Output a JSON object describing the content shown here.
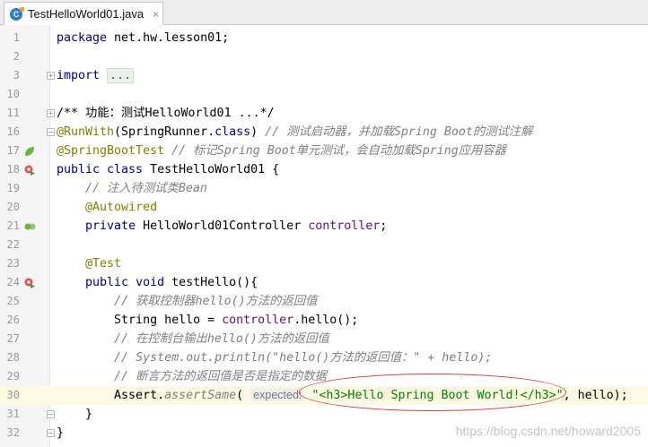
{
  "tab": {
    "icon": "java-class-icon",
    "label": "TestHelloWorld01.java",
    "close": "×"
  },
  "lines": [
    {
      "n": "1",
      "parts": [
        [
          "kw",
          "package "
        ],
        [
          "",
          "net.hw.lesson01;"
        ]
      ]
    },
    {
      "n": "2",
      "parts": []
    },
    {
      "n": "3",
      "parts": [
        [
          "kw",
          "import "
        ],
        [
          "fold-ph",
          "..."
        ]
      ]
    },
    {
      "n": "10",
      "parts": []
    },
    {
      "n": "11",
      "parts": [
        [
          "doc",
          "/** 功能：测试HelloWorld01 ...*/"
        ]
      ]
    },
    {
      "n": "16",
      "parts": [
        [
          "ann",
          "@RunWith"
        ],
        [
          "",
          "(SpringRunner."
        ],
        [
          "kw",
          "class"
        ],
        [
          "",
          ") "
        ],
        [
          "cmt",
          "// 测试启动器，并加载Spring Boot的测试注解"
        ]
      ]
    },
    {
      "n": "17",
      "parts": [
        [
          "ann",
          "@SpringBootTest "
        ],
        [
          "cmt",
          "// 标记Spring Boot单元测试，会自动加载Spring应用容器"
        ]
      ]
    },
    {
      "n": "18",
      "parts": [
        [
          "kw",
          "public class "
        ],
        [
          "",
          "TestHelloWorld01 {"
        ]
      ]
    },
    {
      "n": "19",
      "parts": [
        [
          "",
          "    "
        ],
        [
          "cmt",
          "// 注入待测试类Bean"
        ]
      ]
    },
    {
      "n": "20",
      "parts": [
        [
          "",
          "    "
        ],
        [
          "ann",
          "@Autowired"
        ]
      ]
    },
    {
      "n": "21",
      "parts": [
        [
          "",
          "    "
        ],
        [
          "kw",
          "private "
        ],
        [
          "",
          "HelloWorld01Controller "
        ],
        [
          "fld",
          "controller"
        ],
        [
          "",
          ";"
        ]
      ]
    },
    {
      "n": "22",
      "parts": []
    },
    {
      "n": "23",
      "parts": [
        [
          "",
          "    "
        ],
        [
          "ann",
          "@Test"
        ]
      ]
    },
    {
      "n": "24",
      "parts": [
        [
          "",
          "    "
        ],
        [
          "kw",
          "public void "
        ],
        [
          "",
          "testHello(){"
        ]
      ]
    },
    {
      "n": "25",
      "parts": [
        [
          "",
          "        "
        ],
        [
          "cmt",
          "// 获取控制器hello()方法的返回值"
        ]
      ]
    },
    {
      "n": "26",
      "parts": [
        [
          "",
          "        String hello = "
        ],
        [
          "fld",
          "controller"
        ],
        [
          "",
          ".hello();"
        ]
      ]
    },
    {
      "n": "27",
      "parts": [
        [
          "",
          "        "
        ],
        [
          "cmt",
          "// 在控制台输出hello()方法的返回值"
        ]
      ]
    },
    {
      "n": "28",
      "parts": [
        [
          "",
          "        "
        ],
        [
          "cmt",
          "// System.out.println(\"hello()方法的返回值：\" + hello);"
        ]
      ]
    },
    {
      "n": "29",
      "parts": [
        [
          "",
          "        "
        ],
        [
          "cmt",
          "// 断言方法的返回值是否是指定的数据"
        ]
      ]
    },
    {
      "n": "30",
      "parts": [
        [
          "",
          "        Assert."
        ],
        [
          "cmt",
          "assertSame"
        ],
        [
          "",
          "( "
        ],
        [
          "hint",
          "expected:"
        ],
        [
          "",
          " "
        ],
        [
          "str",
          "\"<h3>Hello Spring Boot World!</h3>\""
        ],
        [
          "",
          ", hello);"
        ]
      ]
    },
    {
      "n": "31",
      "parts": [
        [
          "",
          "    }"
        ]
      ]
    },
    {
      "n": "32",
      "parts": [
        [
          "",
          "}"
        ]
      ]
    }
  ],
  "gutter_icons": {
    "3": "fold-plus",
    "11": "fold-plus",
    "16": "fold-minus",
    "17": "spring-bean-icon",
    "18": "run-test-icon",
    "21": "autowired-bean-icon",
    "24": "run-test-icon",
    "31": "fold-minus",
    "32": "fold-minus"
  },
  "caret_line": "30",
  "watermark": "https://blog.csdn.net/howard2005"
}
